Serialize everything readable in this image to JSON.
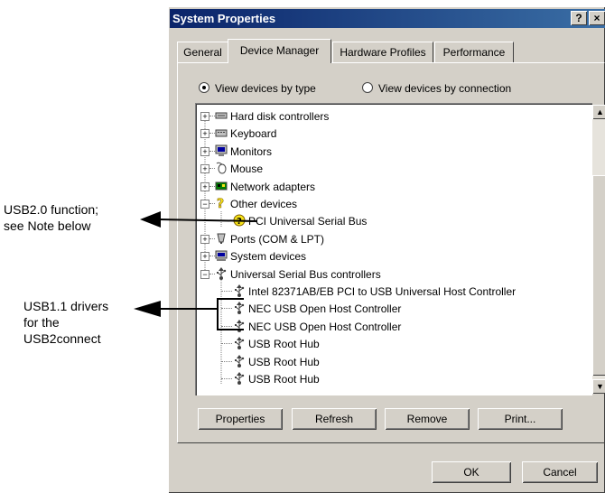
{
  "annotations": {
    "usb2": {
      "lines": [
        "USB2.0 function;",
        "see Note below"
      ]
    },
    "usb11": {
      "lines": [
        "USB1.1 drivers",
        "for the",
        "USB2connect"
      ]
    }
  },
  "window": {
    "title": "System Properties",
    "help_label": "?",
    "close_label": "×"
  },
  "tabs": [
    {
      "label": "General"
    },
    {
      "label": "Device Manager"
    },
    {
      "label": "Hardware Profiles"
    },
    {
      "label": "Performance"
    }
  ],
  "view": {
    "by_type_label": "View devices by type",
    "by_connection_label": "View devices by connection",
    "selected": "by_type"
  },
  "tree": [
    {
      "label": "Hard disk controllers",
      "expander": "+",
      "icon": "disk-controller-icon",
      "level": 0
    },
    {
      "label": "Keyboard",
      "expander": "+",
      "icon": "keyboard-icon",
      "level": 0
    },
    {
      "label": "Monitors",
      "expander": "+",
      "icon": "monitor-icon",
      "level": 0
    },
    {
      "label": "Mouse",
      "expander": "+",
      "icon": "mouse-icon",
      "level": 0
    },
    {
      "label": "Network adapters",
      "expander": "+",
      "icon": "network-adapter-icon",
      "level": 0
    },
    {
      "label": "Other devices",
      "expander": "−",
      "icon": "question-icon",
      "level": 0
    },
    {
      "label": "PCI Universal Serial Bus",
      "expander": "",
      "icon": "unknown-device-icon",
      "level": 1
    },
    {
      "label": "Ports (COM & LPT)",
      "expander": "+",
      "icon": "port-icon",
      "level": 0
    },
    {
      "label": "System devices",
      "expander": "+",
      "icon": "system-device-icon",
      "level": 0
    },
    {
      "label": "Universal Serial Bus controllers",
      "expander": "−",
      "icon": "usb-icon",
      "level": 0
    },
    {
      "label": "Intel 82371AB/EB PCI to USB Universal Host Controller",
      "expander": "",
      "icon": "usb-icon",
      "level": 1
    },
    {
      "label": "NEC USB Open Host Controller",
      "expander": "",
      "icon": "usb-icon",
      "level": 1
    },
    {
      "label": "NEC USB Open Host Controller",
      "expander": "",
      "icon": "usb-icon",
      "level": 1
    },
    {
      "label": "USB Root Hub",
      "expander": "",
      "icon": "usb-icon",
      "level": 1
    },
    {
      "label": "USB Root Hub",
      "expander": "",
      "icon": "usb-icon",
      "level": 1
    },
    {
      "label": "USB Root Hub",
      "expander": "",
      "icon": "usb-icon",
      "level": 1
    }
  ],
  "buttons": {
    "properties": "Properties",
    "refresh": "Refresh",
    "remove": "Remove",
    "print": "Print...",
    "ok": "OK",
    "cancel": "Cancel"
  },
  "colors": {
    "titlebar_start": "#0a246a",
    "titlebar_end": "#3a6ea5",
    "dialog_face": "#d4d0c8",
    "question_yellow": "#f7e418"
  }
}
